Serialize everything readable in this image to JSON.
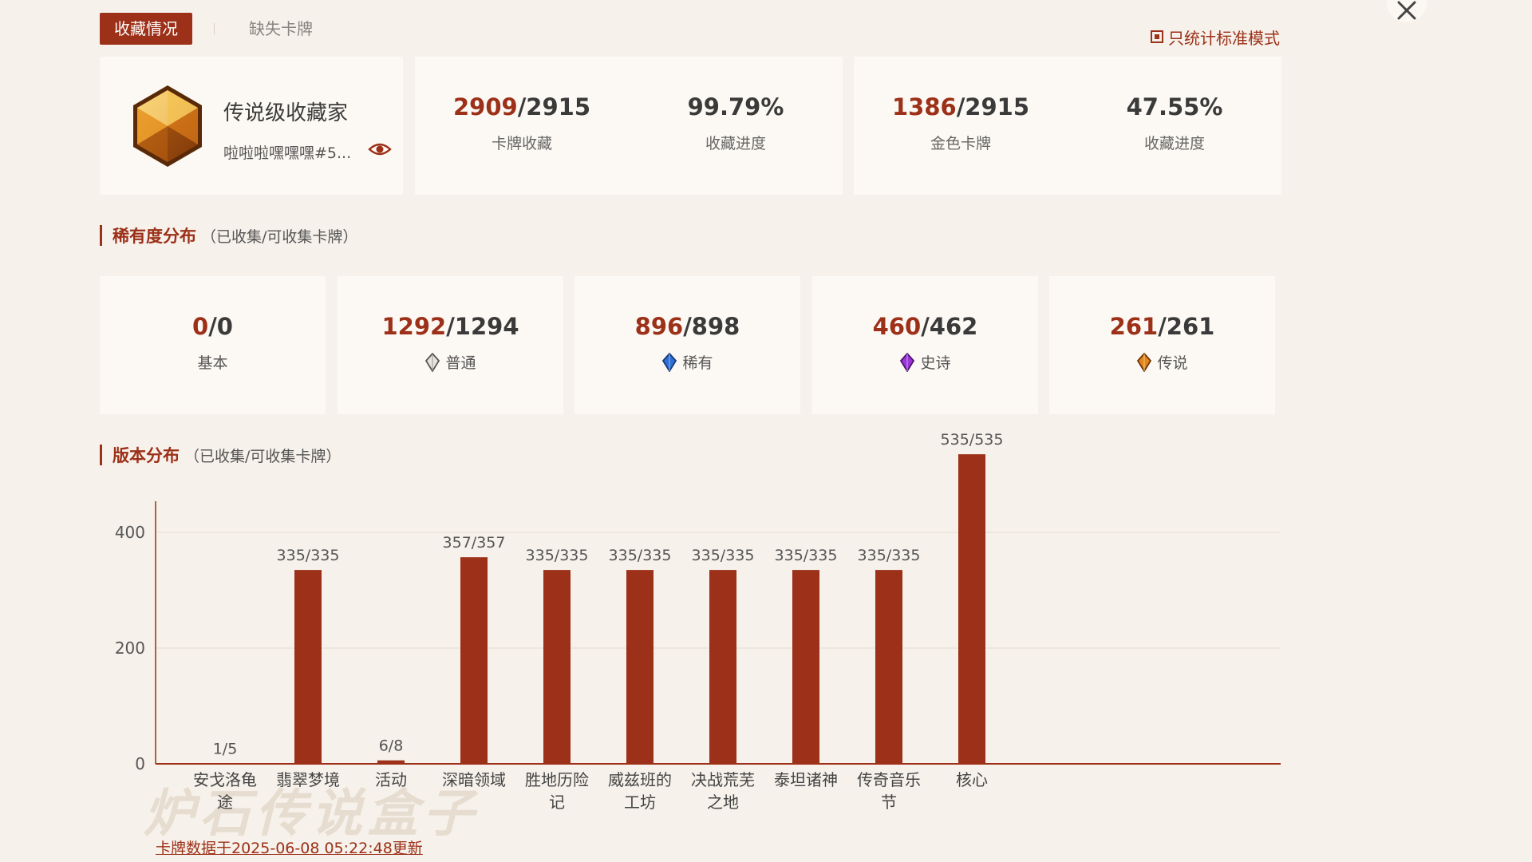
{
  "tabs": {
    "active": "收藏情况",
    "inactive": "缺失卡牌"
  },
  "toggle": {
    "label": "只统计标准模式"
  },
  "profile": {
    "title": "传说级收藏家",
    "user": "啦啦啦嘿嘿嘿#5..."
  },
  "cards": {
    "collected": "2909",
    "total": "/2915",
    "collected_label": "卡牌收藏",
    "progress": "99.79%",
    "progress_label": "收藏进度",
    "golden": "1386",
    "golden_total": "/2915",
    "golden_label": "金色卡牌",
    "golden_progress": "47.55%",
    "golden_progress_label": "收藏进度"
  },
  "rarity_section": {
    "title": "稀有度分布",
    "subtitle": "（已收集/可收集卡牌）"
  },
  "rarity": [
    {
      "have": "0",
      "total": "/0",
      "label": "基本"
    },
    {
      "have": "1292",
      "total": "/1294",
      "label": "普通"
    },
    {
      "have": "896",
      "total": "/898",
      "label": "稀有"
    },
    {
      "have": "460",
      "total": "/462",
      "label": "史诗"
    },
    {
      "have": "261",
      "total": "/261",
      "label": "传说"
    }
  ],
  "version_section": {
    "title": "版本分布",
    "subtitle": "（已收集/可收集卡牌）"
  },
  "chart_data": {
    "type": "bar",
    "categories": [
      [
        "安戈洛龟",
        "途"
      ],
      [
        "翡翠梦境"
      ],
      [
        "活动"
      ],
      [
        "深暗领域"
      ],
      [
        "胜地历险",
        "记"
      ],
      [
        "威兹班的",
        "工坊"
      ],
      [
        "决战荒芜",
        "之地"
      ],
      [
        "泰坦诸神"
      ],
      [
        "传奇音乐",
        "节"
      ],
      [
        "核心"
      ]
    ],
    "values": [
      1,
      335,
      6,
      357,
      335,
      335,
      335,
      335,
      335,
      535
    ],
    "data_labels": [
      "1/5",
      "335/335",
      "6/8",
      "357/357",
      "335/335",
      "335/335",
      "335/335",
      "335/335",
      "335/335",
      "535/535"
    ],
    "yticks": [
      0,
      200,
      400
    ],
    "ylim": [
      0,
      450
    ],
    "bar_color": "#9c3018"
  },
  "footer": "卡牌数据于2025-06-08 05:22:48更新",
  "watermark": "炉石传说盒子"
}
